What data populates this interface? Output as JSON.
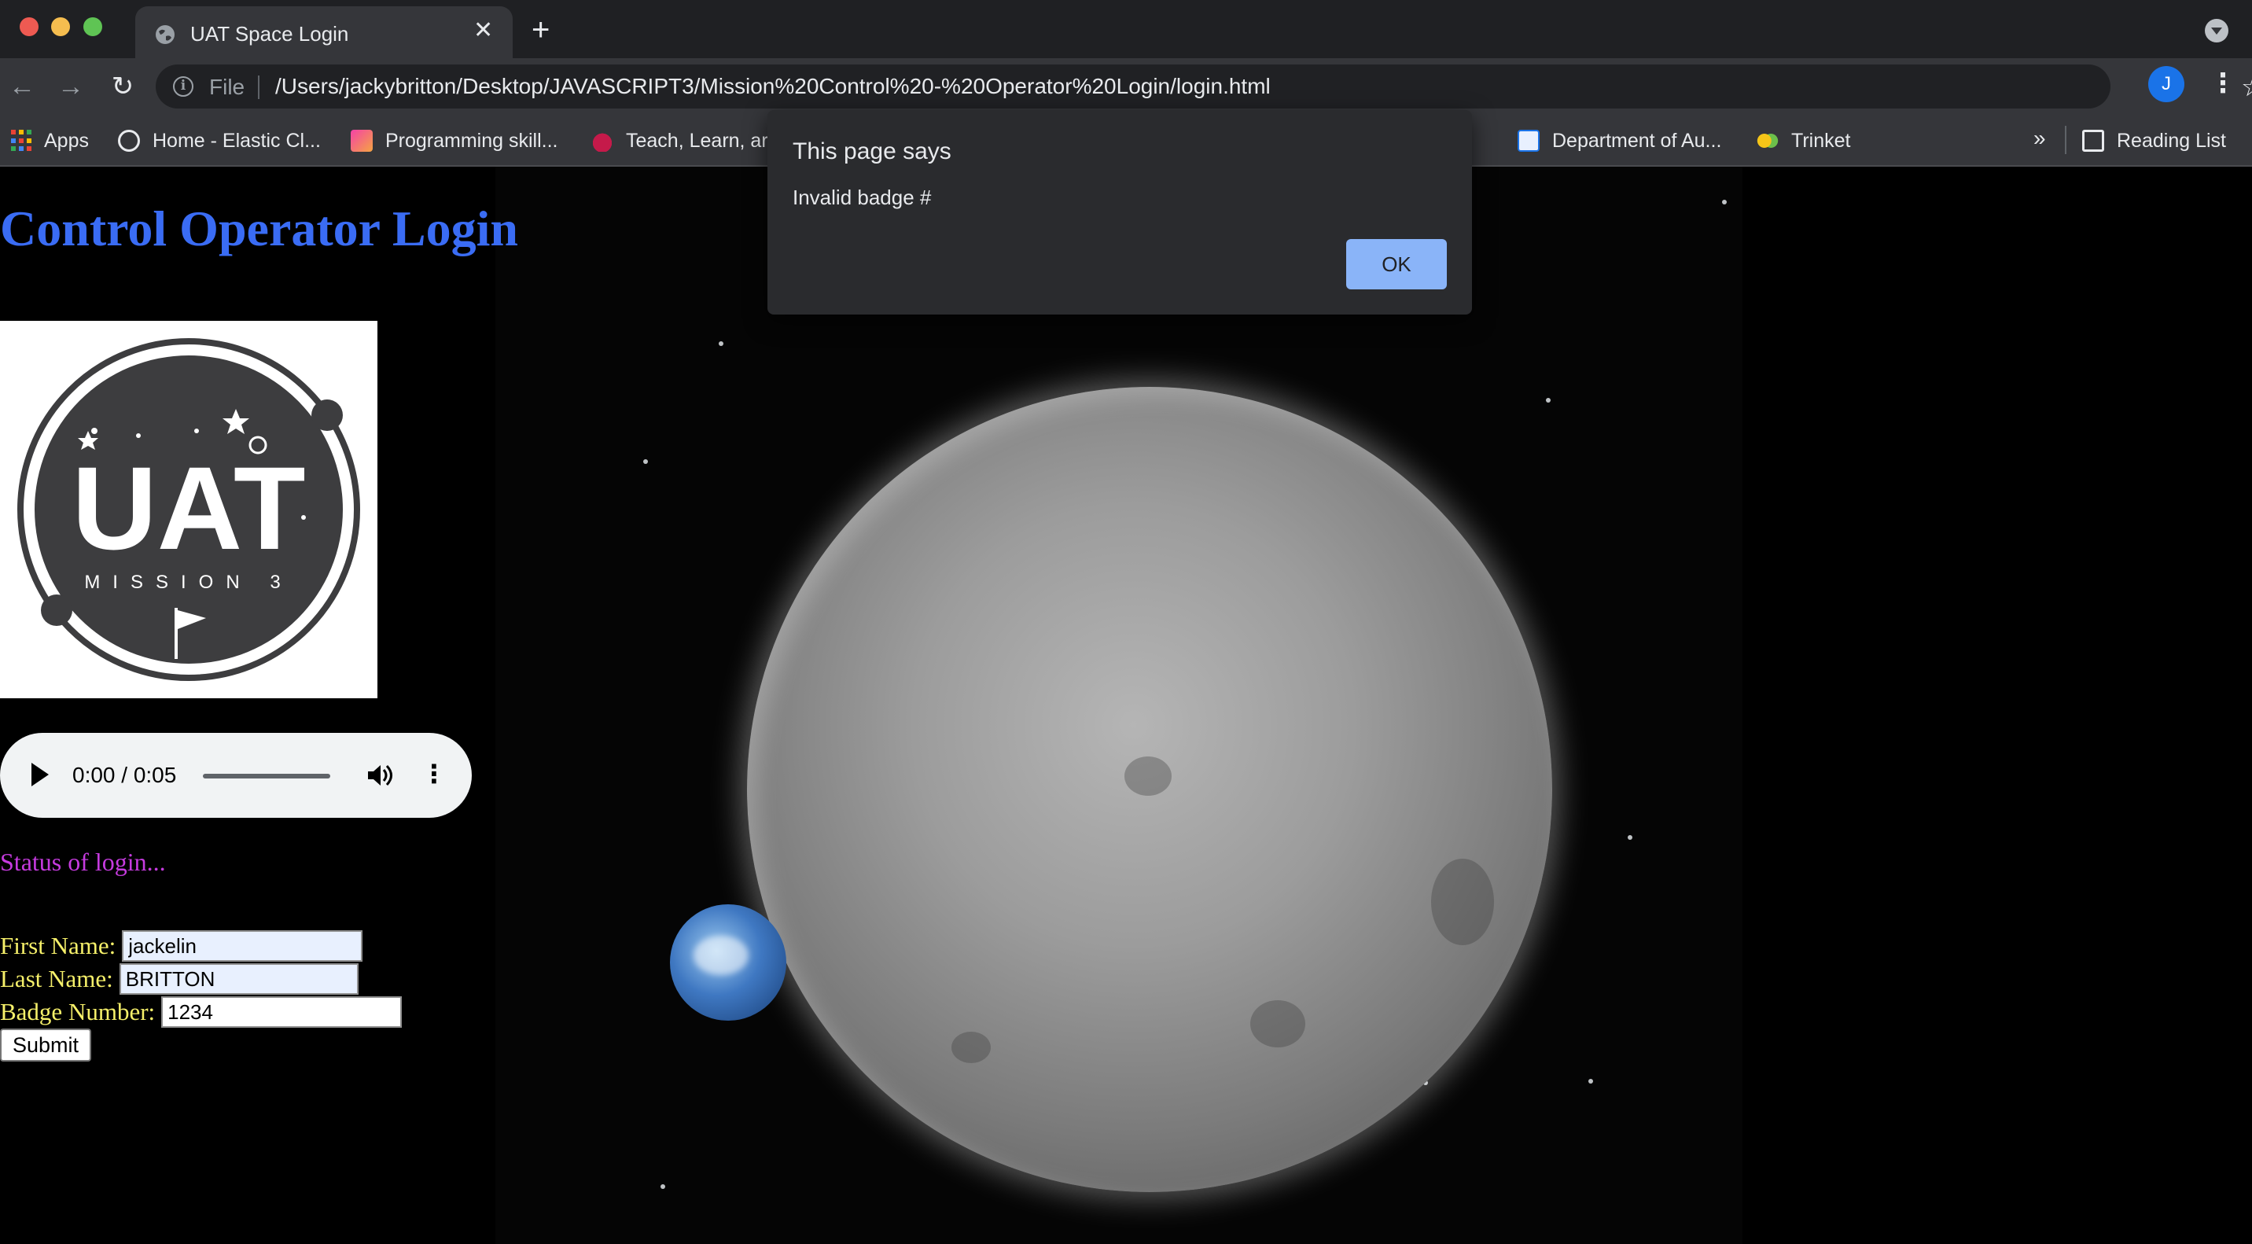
{
  "browser": {
    "tab_title": "UAT Space Login",
    "tab_close": "✕",
    "new_tab": "+",
    "url_scheme": "File",
    "url": "/Users/jackybritton/Desktop/JAVASCRIPT3/Mission%20Control%20-%20Operator%20Login/login.html",
    "profile_initial": "J",
    "bookmarks": [
      {
        "label": "Apps",
        "icon": "apps-grid-icon"
      },
      {
        "label": "Home - Elastic Cl...",
        "icon": "elastic-icon"
      },
      {
        "label": "Programming skill...",
        "icon": "programming-icon"
      },
      {
        "label": "Teach, Learn, ar",
        "icon": "raspberry-pi-icon"
      },
      {
        "label": "Department of Au...",
        "icon": "department-icon"
      },
      {
        "label": "Trinket",
        "icon": "trinket-icon"
      }
    ],
    "bookmarks_overflow": "»",
    "reading_list": "Reading List"
  },
  "page": {
    "title": "Control Operator Login",
    "logo_text": "UAT",
    "logo_subtext": "MISSION 3",
    "audio": {
      "time": "0:00 / 0:05",
      "progress": 0.0
    },
    "status": "Status of login...",
    "form": {
      "first_name_label": "First Name:",
      "first_name_value": "jackelin",
      "last_name_label": "Last Name:",
      "last_name_value": "BRITTON",
      "badge_label": "Badge Number:",
      "badge_value": "1234",
      "submit_label": "Submit"
    }
  },
  "alert": {
    "title": "This page says",
    "message": "Invalid badge #",
    "ok_label": "OK"
  },
  "colors": {
    "title": "#3a6cf4",
    "status": "#c63bdf",
    "labels": "#f6f06a",
    "alert_ok": "#8ab4f8"
  }
}
